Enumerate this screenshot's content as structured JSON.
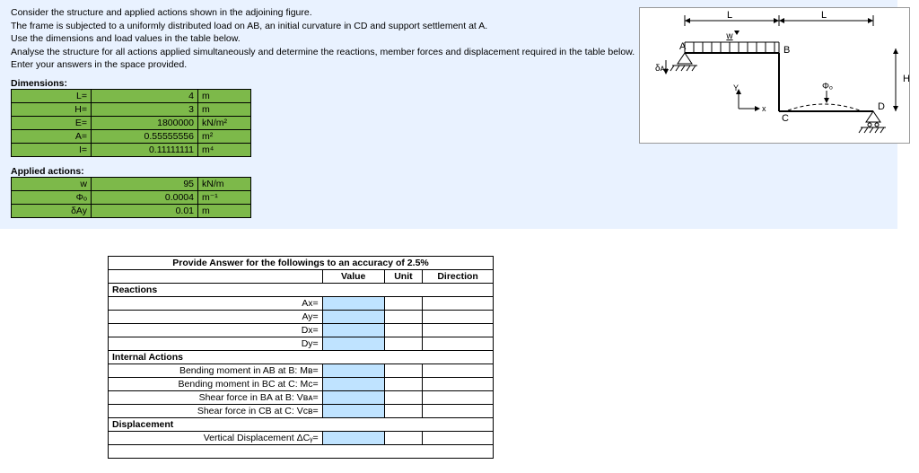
{
  "intro": {
    "l1": "Consider the structure and applied actions shown in the adjoining figure.",
    "l2": "The frame is subjected to a  uniformly distributed load on AB, an initial curvature in CD and support settlement at A.",
    "l3": "Use the dimensions and load values in the table below.",
    "l4": "Analyse the structure for all actions applied simultaneously and determine the reactions, member forces and displacement required in the table below.",
    "l5": "Enter your answers in the space provided."
  },
  "dim_head": "Dimensions:",
  "dims": [
    {
      "k": "L=",
      "v": "4",
      "u": "m"
    },
    {
      "k": "H=",
      "v": "3",
      "u": "m"
    },
    {
      "k": "E=",
      "v": "1800000",
      "u": "kN/m²"
    },
    {
      "k": "A=",
      "v": "0.55555556",
      "u": "m²"
    },
    {
      "k": "I=",
      "v": "0.11111111",
      "u": "m⁴"
    }
  ],
  "act_head": "Applied actions:",
  "acts": [
    {
      "k": "w",
      "v": "95",
      "u": "kN/m"
    },
    {
      "k": "Φₒ",
      "v": "0.0004",
      "u": "m⁻¹"
    },
    {
      "k": "δAy",
      "v": "0.01",
      "u": "m"
    }
  ],
  "ans": {
    "title": "Provide Answer for the followings to an accuracy of 2.5%",
    "col_v": "Value",
    "col_u": "Unit",
    "col_d": "Direction",
    "s1": "Reactions",
    "r1": "Ax=",
    "r2": "Ay=",
    "r3": "Dx=",
    "r4": "Dy=",
    "s2": "Internal Actions",
    "r5": "Bending moment in AB at B: Mʙ=",
    "r6": "Bending moment in BC at C: Mᴄ=",
    "r7": "Shear force in BA at B: Vʙᴀ=",
    "r8": "Shear force in CB at C: Vᴄʙ=",
    "s3": "Displacement",
    "r9": "Vertical Displacement ΔCᵧ="
  },
  "diag": {
    "A": "A",
    "B": "B",
    "C": "C",
    "D": "D",
    "L": "L",
    "H": "H",
    "w": "w",
    "phi": "Φₒ",
    "day": "δᴀᵧ",
    "x": "x",
    "y": "Y"
  }
}
